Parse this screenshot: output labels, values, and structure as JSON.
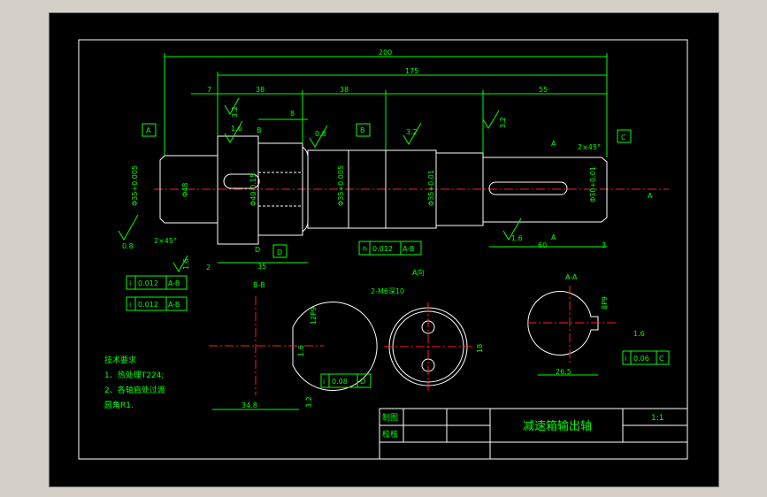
{
  "colors": {
    "background": "#000000",
    "lines": "#00ff00",
    "outline": "#ffffff",
    "centerline": "#ff2020"
  },
  "dimensions": {
    "overall": "200",
    "middle": "175",
    "d7": "7",
    "d38a": "38",
    "d38b": "38",
    "d55": "55",
    "d8": "8",
    "d35": "35",
    "d60": "60",
    "d3": "3",
    "d2": "2",
    "bb_width": "34.8",
    "aa_width": "26.5",
    "hole_spacing": "18",
    "key_bb": "12P9",
    "key_aa": "8P9"
  },
  "diameters": {
    "d1": "Φ35+0.005",
    "d2": "Φ48",
    "d3": "Φ40-0.15",
    "d4": "Φ35+0.005",
    "d5": "Φ35+0.01",
    "d6": "Φ30+0.01"
  },
  "chamfers": {
    "left": "2×45°",
    "right": "2×45°"
  },
  "roughness": [
    "3.2",
    "1.6",
    "0.8",
    "3.2",
    "3.2",
    "0.8",
    "1.6",
    "1.6",
    "1.6",
    "3.2",
    "1.6"
  ],
  "datums": {
    "a": "A",
    "b": "B",
    "c": "C",
    "d": "D"
  },
  "section_marks": {
    "b": "B",
    "d": "D",
    "a": "A",
    "a_dir": "A"
  },
  "tolerance_frames": [
    {
      "sym": "h",
      "val": "0.012",
      "ref": "A-B"
    },
    {
      "sym": "i",
      "val": "0.012",
      "ref": "A-B"
    },
    {
      "sym": "i",
      "val": "0.012",
      "ref": "A-B"
    },
    {
      "sym": "i",
      "val": "0.08",
      "ref": "D"
    },
    {
      "sym": "i",
      "val": "0.06",
      "ref": "C"
    }
  ],
  "views": {
    "bb": "B-B",
    "adir": "A向",
    "aa": "A-A",
    "tapped_holes": "2-M6深10"
  },
  "notes": {
    "title": "技术要求",
    "line1": "1、热处理T224;",
    "line2": "2、各轴肩处过渡",
    "line3": "圆角R1."
  },
  "title_block": {
    "drawn": "制图",
    "checked": "校核",
    "part_name": "减速箱输出轴",
    "scale": "1:1"
  }
}
